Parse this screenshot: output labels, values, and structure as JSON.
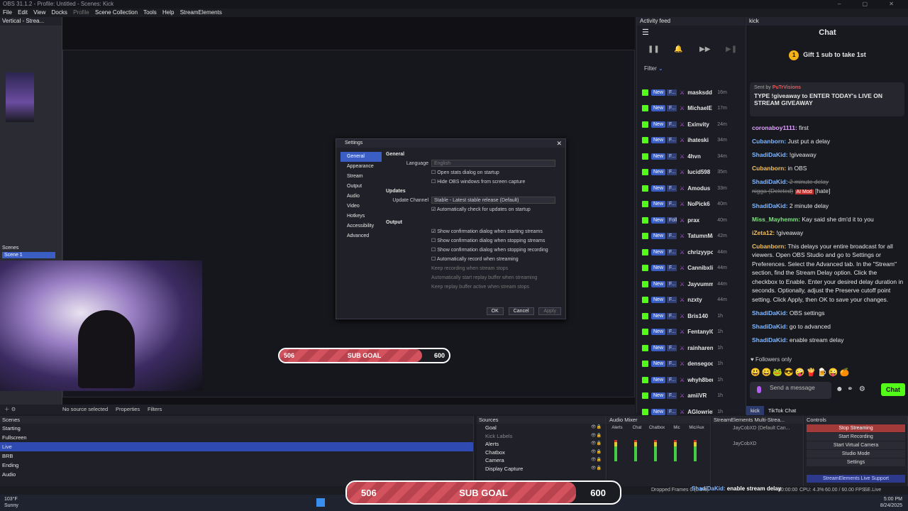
{
  "window": {
    "title": "OBS 31.1.2 - Profile: Untitled - Scenes: Kick",
    "controls": "–  ▢  ✕"
  },
  "menu": [
    "File",
    "Edit",
    "View",
    "Docks",
    "Profile",
    "Scene Collection",
    "Tools",
    "Help",
    "StreamElements"
  ],
  "vertical_panel": {
    "title": "Vertical - Strea..."
  },
  "preview_scenes": {
    "title": "Scenes",
    "selected": "Scene 1"
  },
  "settings_dialog": {
    "title": "Settings",
    "nav": [
      "General",
      "Appearance",
      "Stream",
      "Output",
      "Audio",
      "Video",
      "Hotkeys",
      "Accessibility",
      "Advanced"
    ],
    "general_header": "General",
    "language_label": "Language",
    "language_value": "English",
    "opt_stats": "Open stats dialog on startup",
    "opt_hide": "Hide OBS windows from screen capture",
    "updates_header": "Updates",
    "update_channel_label": "Update Channel",
    "update_channel_value": "Stable - Latest stable release (Default)",
    "opt_auto_update": "Automatically check for updates on startup",
    "output_header": "Output",
    "output_options": [
      "Show confirmation dialog when starting streams",
      "Show confirmation dialog when stopping streams",
      "Show confirmation dialog when stopping recording",
      "Automatically record when streaming",
      "Keep recording when stream stops",
      "Automatically start replay buffer when streaming",
      "Keep replay buffer active when stream stops"
    ],
    "ok": "OK",
    "cancel": "Cancel",
    "apply": "Apply"
  },
  "sub_goal": {
    "current": "506",
    "label": "SUB GOAL",
    "target": "600",
    "progress_fraction": 0.84
  },
  "activity_feed": {
    "title": "Activity feed",
    "filter": "Filter",
    "rows": [
      {
        "badge": "New",
        "sub": "F...",
        "name": "masksdd",
        "time": "16m"
      },
      {
        "badge": "New",
        "sub": "F...",
        "name": "MichaelE",
        "time": "17m"
      },
      {
        "badge": "New",
        "sub": "F...",
        "name": "Exinvity",
        "time": "24m"
      },
      {
        "badge": "New",
        "sub": "F...",
        "name": "ihateski",
        "time": "34m"
      },
      {
        "badge": "New",
        "sub": "F...",
        "name": "4hvn",
        "time": "34m"
      },
      {
        "badge": "New",
        "sub": "F...",
        "name": "lucid598",
        "time": "35m"
      },
      {
        "badge": "New",
        "sub": "F...",
        "name": "Amodus",
        "time": "33m"
      },
      {
        "badge": "New",
        "sub": "F...",
        "name": "NoPick6",
        "time": "40m"
      },
      {
        "badge": "New",
        "sub": "Foll...",
        "name": "prax",
        "time": "40m"
      },
      {
        "badge": "New",
        "sub": "F...",
        "name": "TatumnMa",
        "time": "42m"
      },
      {
        "badge": "New",
        "sub": "F...",
        "name": "chrizyypo",
        "time": "44m"
      },
      {
        "badge": "New",
        "sub": "F...",
        "name": "Cannibxlis",
        "time": "44m"
      },
      {
        "badge": "New",
        "sub": "F...",
        "name": "Jayvumm",
        "time": "44m"
      },
      {
        "badge": "New",
        "sub": "F...",
        "name": "nzxty",
        "time": "44m"
      },
      {
        "badge": "New",
        "sub": "F...",
        "name": "Bris140",
        "time": "1h"
      },
      {
        "badge": "New",
        "sub": "F...",
        "name": "FentanylG",
        "time": "1h"
      },
      {
        "badge": "New",
        "sub": "F...",
        "name": "rainharenr",
        "time": "1h"
      },
      {
        "badge": "New",
        "sub": "F...",
        "name": "densegod",
        "time": "1h"
      },
      {
        "badge": "New",
        "sub": "F...",
        "name": "whyh8beu",
        "time": "1h"
      },
      {
        "badge": "New",
        "sub": "F...",
        "name": "amiiVR",
        "time": "1h"
      },
      {
        "badge": "New",
        "sub": "F...",
        "name": "AGlowrieS",
        "time": "1h"
      }
    ]
  },
  "chat": {
    "panel_title": "kick",
    "title": "Chat",
    "gift_count": "1",
    "gift_text": "Gift 1 sub to take 1st",
    "pinned_by_label": "Sent by",
    "pinned_by_user": "PuTrVisions",
    "pinned_message": "TYPE !giveaway to ENTER TODAY's LIVE ON STREAM GIVEAWAY",
    "messages": [
      {
        "user": "coronaboy1111:",
        "text": " first",
        "color": "#e0a3ff"
      },
      {
        "user": "Cubanborn:",
        "text": " Just put a delay",
        "color": "#7fb6ff"
      },
      {
        "user": "ShadiDaKid:",
        "text": " !giveaway",
        "color": "#7fb6ff"
      },
      {
        "user": "Cubanborn:",
        "text": " in OBS",
        "color": "#f0c060"
      },
      {
        "user": "ShadiDaKid:",
        "text": " 2 minute delay",
        "deleted": true,
        "extra": "nigga (Deleted)",
        "mod": "AI Mod",
        "tag": "[hate]",
        "color": "#7fb6ff"
      },
      {
        "user": "ShadiDaKid:",
        "text": " 2 minute delay",
        "color": "#7fb6ff"
      },
      {
        "user": "Miss_Mayhemm:",
        "text": " Kay said she dm'd it to you",
        "color": "#7fe07f"
      },
      {
        "user": "iZeta12:",
        "text": " !giveaway",
        "color": "#f0c060"
      },
      {
        "user": "Cubanborn:",
        "text": " This delays your entire broadcast for all viewers. Open OBS Studio and go to Settings or Preferences. Select the Advanced tab. In the \"Stream\" section, find the Stream Delay option. Click the checkbox to Enable. Enter your desired delay duration in seconds. Optionally, adjust the Preserve cutoff point setting. Click Apply, then OK to save your changes.",
        "color": "#f0c060"
      },
      {
        "user": "ShadiDaKid:",
        "text": " OBS settings",
        "color": "#7fb6ff"
      },
      {
        "user": "ShadiDaKid:",
        "text": " go to advanced",
        "color": "#7fb6ff"
      },
      {
        "user": "ShadiDaKid:",
        "text": " enable stream delay",
        "color": "#7fb6ff"
      }
    ],
    "followers_only": "Followers only",
    "send_placeholder": "Send a message",
    "chat_button": "Chat",
    "tabs": [
      "kick",
      "TikTok Chat"
    ]
  },
  "source_toolbar": {
    "no_source": "No source selected",
    "properties": "Properties",
    "filters": "Filters"
  },
  "scenes_dock": {
    "title": "Scenes",
    "items": [
      "Starting",
      "Fullscreen",
      "Live",
      "BRB",
      "Ending",
      "Audio"
    ],
    "selected": "Live"
  },
  "sources_dock": {
    "title": "Sources",
    "items": [
      "Goal",
      "Kick Labels",
      "Alerts",
      "Chatbox",
      "Camera",
      "Display Capture"
    ]
  },
  "mixer_dock": {
    "title": "Audio Mixer",
    "channels": [
      "Alerts",
      "Chat",
      "Chatbox",
      "Mic",
      "Mic/Aux"
    ]
  },
  "multistream_dock": {
    "title": "StreamElements Multi-Strea...",
    "rows": [
      "JayCobXD (Default Can...",
      "JayCobXD",
      ""
    ]
  },
  "controls_dock": {
    "title": "Controls",
    "buttons": [
      "Stop Streaming",
      "Start Recording",
      "Start Virtual Camera",
      "Studio Mode",
      "Settings",
      "StreamElements Live Support"
    ]
  },
  "status": {
    "dropped": "Dropped Frames 0 (0.0%)",
    "overlay_user": "ShadiDaKid:",
    "overlay_text": "enable stream delay",
    "time1": "00:00:00",
    "time2": "00:00:00",
    "cpu": "CPU: 4.3%",
    "fps": "60.00 / 60.00 FPS",
    "se": "SE.Live 25.6.19.485"
  },
  "taskbar": {
    "temp": "103°F",
    "weather": "Sunny",
    "time": "5:00 PM",
    "date": "8/24/2025"
  },
  "colors": {
    "accent": "#3b5ec4",
    "kick_green": "#53fc18",
    "goal_red": "#d2535e"
  }
}
